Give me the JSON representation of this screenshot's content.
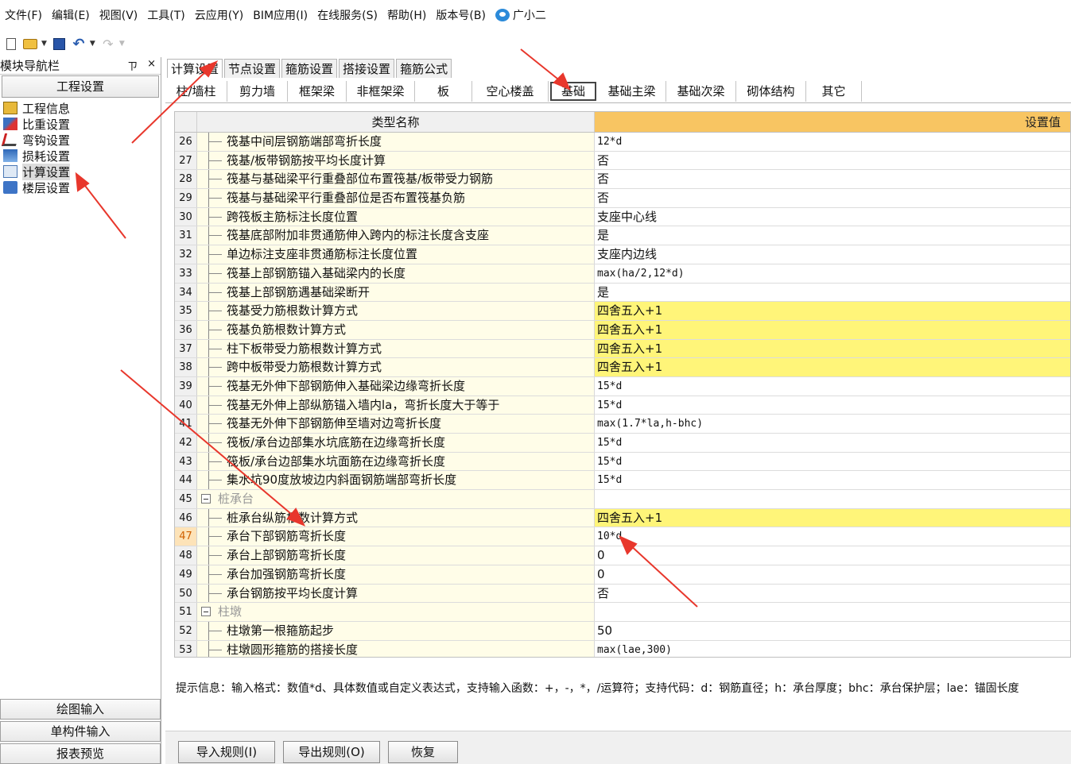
{
  "menu": {
    "items": [
      "文件(F)",
      "编辑(E)",
      "视图(V)",
      "工具(T)",
      "云应用(Y)",
      "BIM应用(I)",
      "在线服务(S)",
      "帮助(H)",
      "版本号(B)"
    ],
    "helper": "广小二"
  },
  "toolbar": {
    "icons": [
      "new-file-icon",
      "open-folder-icon",
      "save-icon",
      "undo-icon",
      "redo-icon"
    ]
  },
  "left_panel": {
    "title": "模块导航栏",
    "pin": "ㄗ",
    "close": "×",
    "section": "工程设置",
    "items": [
      {
        "label": "工程信息",
        "icon": "project-info-icon"
      },
      {
        "label": "比重设置",
        "icon": "ratio-icon"
      },
      {
        "label": "弯钩设置",
        "icon": "hook-icon"
      },
      {
        "label": "损耗设置",
        "icon": "loss-icon"
      },
      {
        "label": "计算设置",
        "icon": "calc-icon"
      },
      {
        "label": "楼层设置",
        "icon": "floor-icon"
      }
    ],
    "bottom_sections": [
      "绘图输入",
      "单构件输入",
      "报表预览"
    ]
  },
  "tabs_main": [
    "计算设置",
    "节点设置",
    "箍筋设置",
    "搭接设置",
    "箍筋公式"
  ],
  "tabs_sub": [
    "柱/墙柱",
    "剪力墙",
    "框架梁",
    "非框架梁",
    "板",
    "空心楼盖",
    "基础",
    "基础主梁",
    "基础次梁",
    "砌体结构",
    "其它"
  ],
  "table": {
    "col_name": "类型名称",
    "col_value": "设置值",
    "rows": [
      {
        "no": "26",
        "name": "筏基中间层钢筋端部弯折长度",
        "value": "12*d"
      },
      {
        "no": "27",
        "name": "筏基/板带钢筋按平均长度计算",
        "value": "否"
      },
      {
        "no": "28",
        "name": "筏基与基础梁平行重叠部位布置筏基/板带受力钢筋",
        "value": "否"
      },
      {
        "no": "29",
        "name": "筏基与基础梁平行重叠部位是否布置筏基负筋",
        "value": "否"
      },
      {
        "no": "30",
        "name": "跨筏板主筋标注长度位置",
        "value": "支座中心线"
      },
      {
        "no": "31",
        "name": "筏基底部附加非贯通筋伸入跨内的标注长度含支座",
        "value": "是"
      },
      {
        "no": "32",
        "name": "单边标注支座非贯通筋标注长度位置",
        "value": "支座内边线"
      },
      {
        "no": "33",
        "name": "筏基上部钢筋锚入基础梁内的长度",
        "value": "max(ha/2,12*d)"
      },
      {
        "no": "34",
        "name": "筏基上部钢筋遇基础梁断开",
        "value": "是"
      },
      {
        "no": "35",
        "name": "筏基受力筋根数计算方式",
        "value": "四舍五入+1"
      },
      {
        "no": "36",
        "name": "筏基负筋根数计算方式",
        "value": "四舍五入+1"
      },
      {
        "no": "37",
        "name": "柱下板带受力筋根数计算方式",
        "value": "四舍五入+1"
      },
      {
        "no": "38",
        "name": "跨中板带受力筋根数计算方式",
        "value": "四舍五入+1"
      },
      {
        "no": "39",
        "name": "筏基无外伸下部钢筋伸入基础梁边缘弯折长度",
        "value": "15*d"
      },
      {
        "no": "40",
        "name": "筏基无外伸上部纵筋锚入墙内la，弯折长度大于等于",
        "value": "15*d"
      },
      {
        "no": "41",
        "name": "筏基无外伸下部钢筋伸至墙对边弯折长度",
        "value": "max(1.7*la,h-bhc)"
      },
      {
        "no": "42",
        "name": "筏板/承台边部集水坑底筋在边缘弯折长度",
        "value": "15*d"
      },
      {
        "no": "43",
        "name": "筏板/承台边部集水坑面筋在边缘弯折长度",
        "value": "15*d"
      },
      {
        "no": "44",
        "name": "集水坑90度放坡边内斜面钢筋端部弯折长度",
        "value": "15*d"
      },
      {
        "no": "45",
        "name": "桩承台",
        "value": ""
      },
      {
        "no": "46",
        "name": "桩承台纵筋根数计算方式",
        "value": "四舍五入+1"
      },
      {
        "no": "47",
        "name": "承台下部钢筋弯折长度",
        "value": "10*d"
      },
      {
        "no": "48",
        "name": "承台上部钢筋弯折长度",
        "value": "0"
      },
      {
        "no": "49",
        "name": "承台加强钢筋弯折长度",
        "value": "0"
      },
      {
        "no": "50",
        "name": "承台钢筋按平均长度计算",
        "value": "否"
      },
      {
        "no": "51",
        "name": "柱墩",
        "value": ""
      },
      {
        "no": "52",
        "name": "柱墩第一根箍筋起步",
        "value": "50"
      },
      {
        "no": "53",
        "name": "柱墩圆形箍筋的搭接长度",
        "value": "max(lae,300)"
      }
    ]
  },
  "hint": "提示信息：输入格式：数值*d、具体数值或自定义表达式，支持输入函数：+，-，*，/运算符；支持代码：d：钢筋直径；h：承台厚度；bhc：承台保护层；lae：锚固长度",
  "buttons": {
    "import": "导入规则(I)",
    "export": "导出规则(O)",
    "restore": "恢复"
  },
  "colors": {
    "header_value_bg": "#f8c562",
    "highlight_value_bg": "#fff579",
    "name_cell_bg": "#fffde8",
    "annotation_arrow": "#e8372c"
  }
}
